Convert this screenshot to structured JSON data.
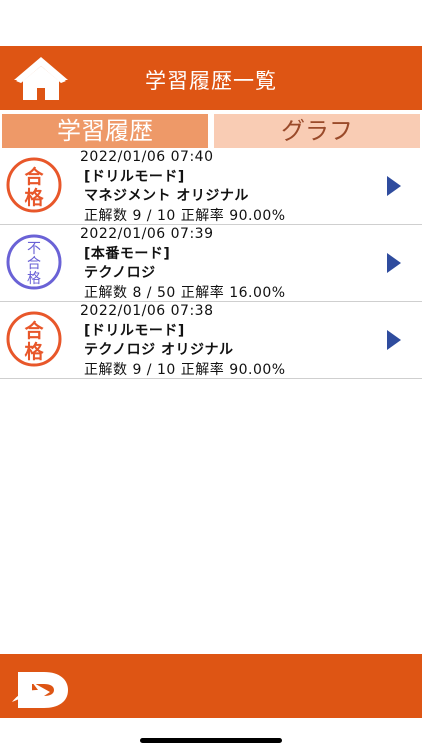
{
  "header": {
    "title": "学習履歴一覧"
  },
  "tabs": [
    {
      "label": "学習履歴",
      "active": true
    },
    {
      "label": "グラフ",
      "active": false
    }
  ],
  "history": [
    {
      "date": "2022/01/06 07:40",
      "mode": "[ドリルモード]",
      "name": "マネジメント オリジナル",
      "score": "正解数 9 / 10 正解率 90.00%",
      "badge_line1": "合",
      "badge_line2": "格",
      "badge_line3": "",
      "passed": true
    },
    {
      "date": "2022/01/06 07:39",
      "mode": "[本番モード]",
      "name": "テクノロジ",
      "score": "正解数 8 / 50 正解率 16.00%",
      "badge_line1": "不",
      "badge_line2": "合",
      "badge_line3": "格",
      "passed": false
    },
    {
      "date": "2022/01/06 07:38",
      "mode": "[ドリルモード]",
      "name": "テクノロジ オリジナル",
      "score": "正解数 9 / 10 正解率 90.00%",
      "badge_line1": "合",
      "badge_line2": "格",
      "badge_line3": "",
      "passed": true
    }
  ],
  "colors": {
    "accent": "#DE5514",
    "pass": "#E8572A",
    "fail": "#6A62D6",
    "arrow": "#2F4C9E"
  }
}
